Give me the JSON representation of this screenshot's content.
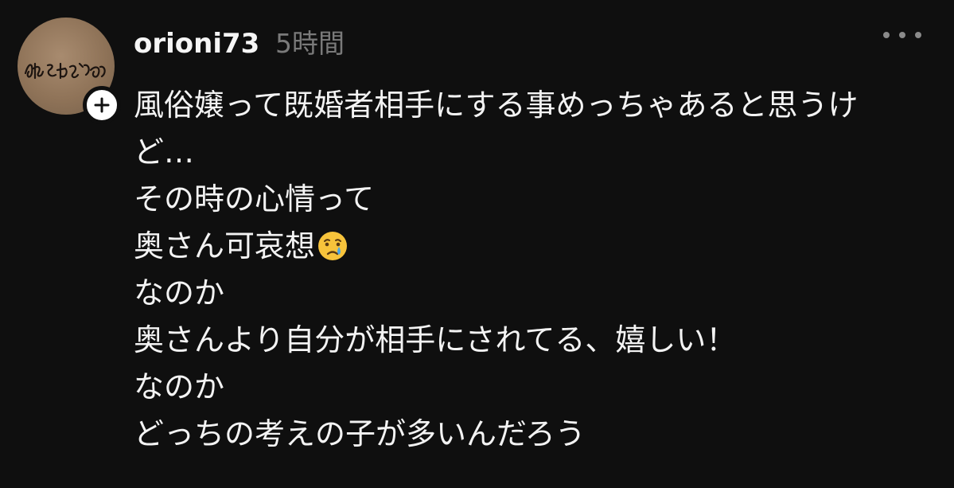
{
  "post": {
    "username": "orioni73",
    "timestamp": "5時間",
    "avatar_text": "えちおぴあ",
    "follow_icon": "plus-icon",
    "more_icon": "more-dots-icon",
    "emoji_icon": "crying-face-emoji",
    "lines": [
      "風俗嬢って既婚者相手にする事めっちゃあると思うけ",
      "ど…",
      "その時の心情って",
      "奥さん可哀想",
      "なのか",
      "奥さんより自分が相手にされてる、嬉しい！",
      "なのか",
      "どっちの考えの子が多いんだろう"
    ]
  },
  "colors": {
    "background": "#0f0f0f",
    "text": "#f3f3f3",
    "muted": "#7a7a7a",
    "badge": "#ffffff"
  }
}
